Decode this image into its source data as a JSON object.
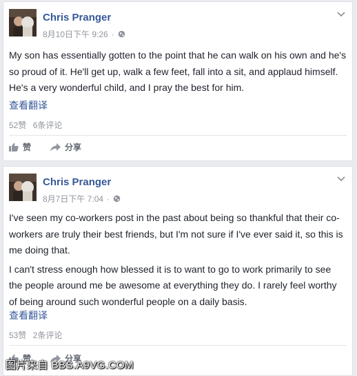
{
  "posts": [
    {
      "author": "Chris Pranger",
      "timestamp": "8月10日下午 9:26",
      "separator": "·",
      "paragraphs": [
        "My son has essentially gotten to the point that he can walk on his own and he's so proud of it. He'll get up, walk a few feet, fall into a sit, and applaud himself. He's a very wonderful child, and I pray the best for him."
      ],
      "translate_label": "查看翻译",
      "likes": "52赞",
      "comments": "6条评论",
      "like_label": "赞",
      "share_label": "分享",
      "icons": [
        "avatar",
        "globe-icon",
        "chevron-down-icon",
        "thumbs-up-icon",
        "share-arrow-icon"
      ]
    },
    {
      "author": "Chris Pranger",
      "timestamp": "8月7日下午 7:04",
      "separator": "·",
      "paragraphs": [
        "I've seen my co-workers post in the past about being so thankful that their co-workers are truly their best friends, but I'm not sure if I've ever said it, so this is me doing that.",
        "I can't stress enough how blessed it is to want to go to work primarily to see the people around me be awesome at everything they do. I rarely feel worthy of being around such wonderful people on a daily basis."
      ],
      "translate_label": "查看翻译",
      "likes": "53赞",
      "comments": "2条评论",
      "like_label": "赞",
      "share_label": "分享",
      "icons": [
        "avatar",
        "globe-icon",
        "chevron-down-icon",
        "thumbs-up-icon",
        "share-arrow-icon"
      ]
    }
  ],
  "watermark": "图片来自 BBS.A9VG.COM",
  "colors": {
    "page_bg": "#e9ebee",
    "card_bg": "#ffffff",
    "link_blue": "#365899",
    "muted_gray": "#90949c",
    "text": "#1d2129"
  }
}
